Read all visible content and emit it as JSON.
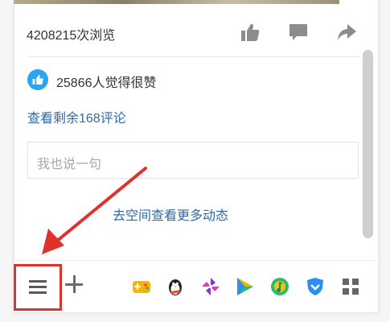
{
  "post": {
    "views_text": "4208215次浏览",
    "likes_text": "25866人觉得很赞",
    "more_comments_link": "查看剩余168评论",
    "comment_placeholder": "我也说一句",
    "space_link": "去空间查看更多动态"
  },
  "actions": [
    {
      "name": "like",
      "icon": "thumbs-up-icon"
    },
    {
      "name": "comment",
      "icon": "speech-bubble-icon"
    },
    {
      "name": "share",
      "icon": "share-arrow-icon"
    }
  ],
  "toolbar": {
    "menu_icon": "hamburger-menu-icon",
    "add_icon": "plus-icon",
    "apps": [
      {
        "name": "game-icon",
        "color": "#f6b400"
      },
      {
        "name": "penguin-icon",
        "color": "#e05a2a"
      },
      {
        "name": "pinwheel-icon",
        "color": "#8a35d6"
      },
      {
        "name": "video-play-icon",
        "color": "#2dbb6b"
      },
      {
        "name": "music-icon",
        "color": "#f1c21b"
      },
      {
        "name": "shield-icon",
        "color": "#2a8ff0"
      },
      {
        "name": "grid-apps-icon",
        "color": "#666666"
      }
    ]
  },
  "colors": {
    "link": "#2d6aa6",
    "highlight": "#e0322c",
    "like_badge": "#2aa4f4"
  }
}
